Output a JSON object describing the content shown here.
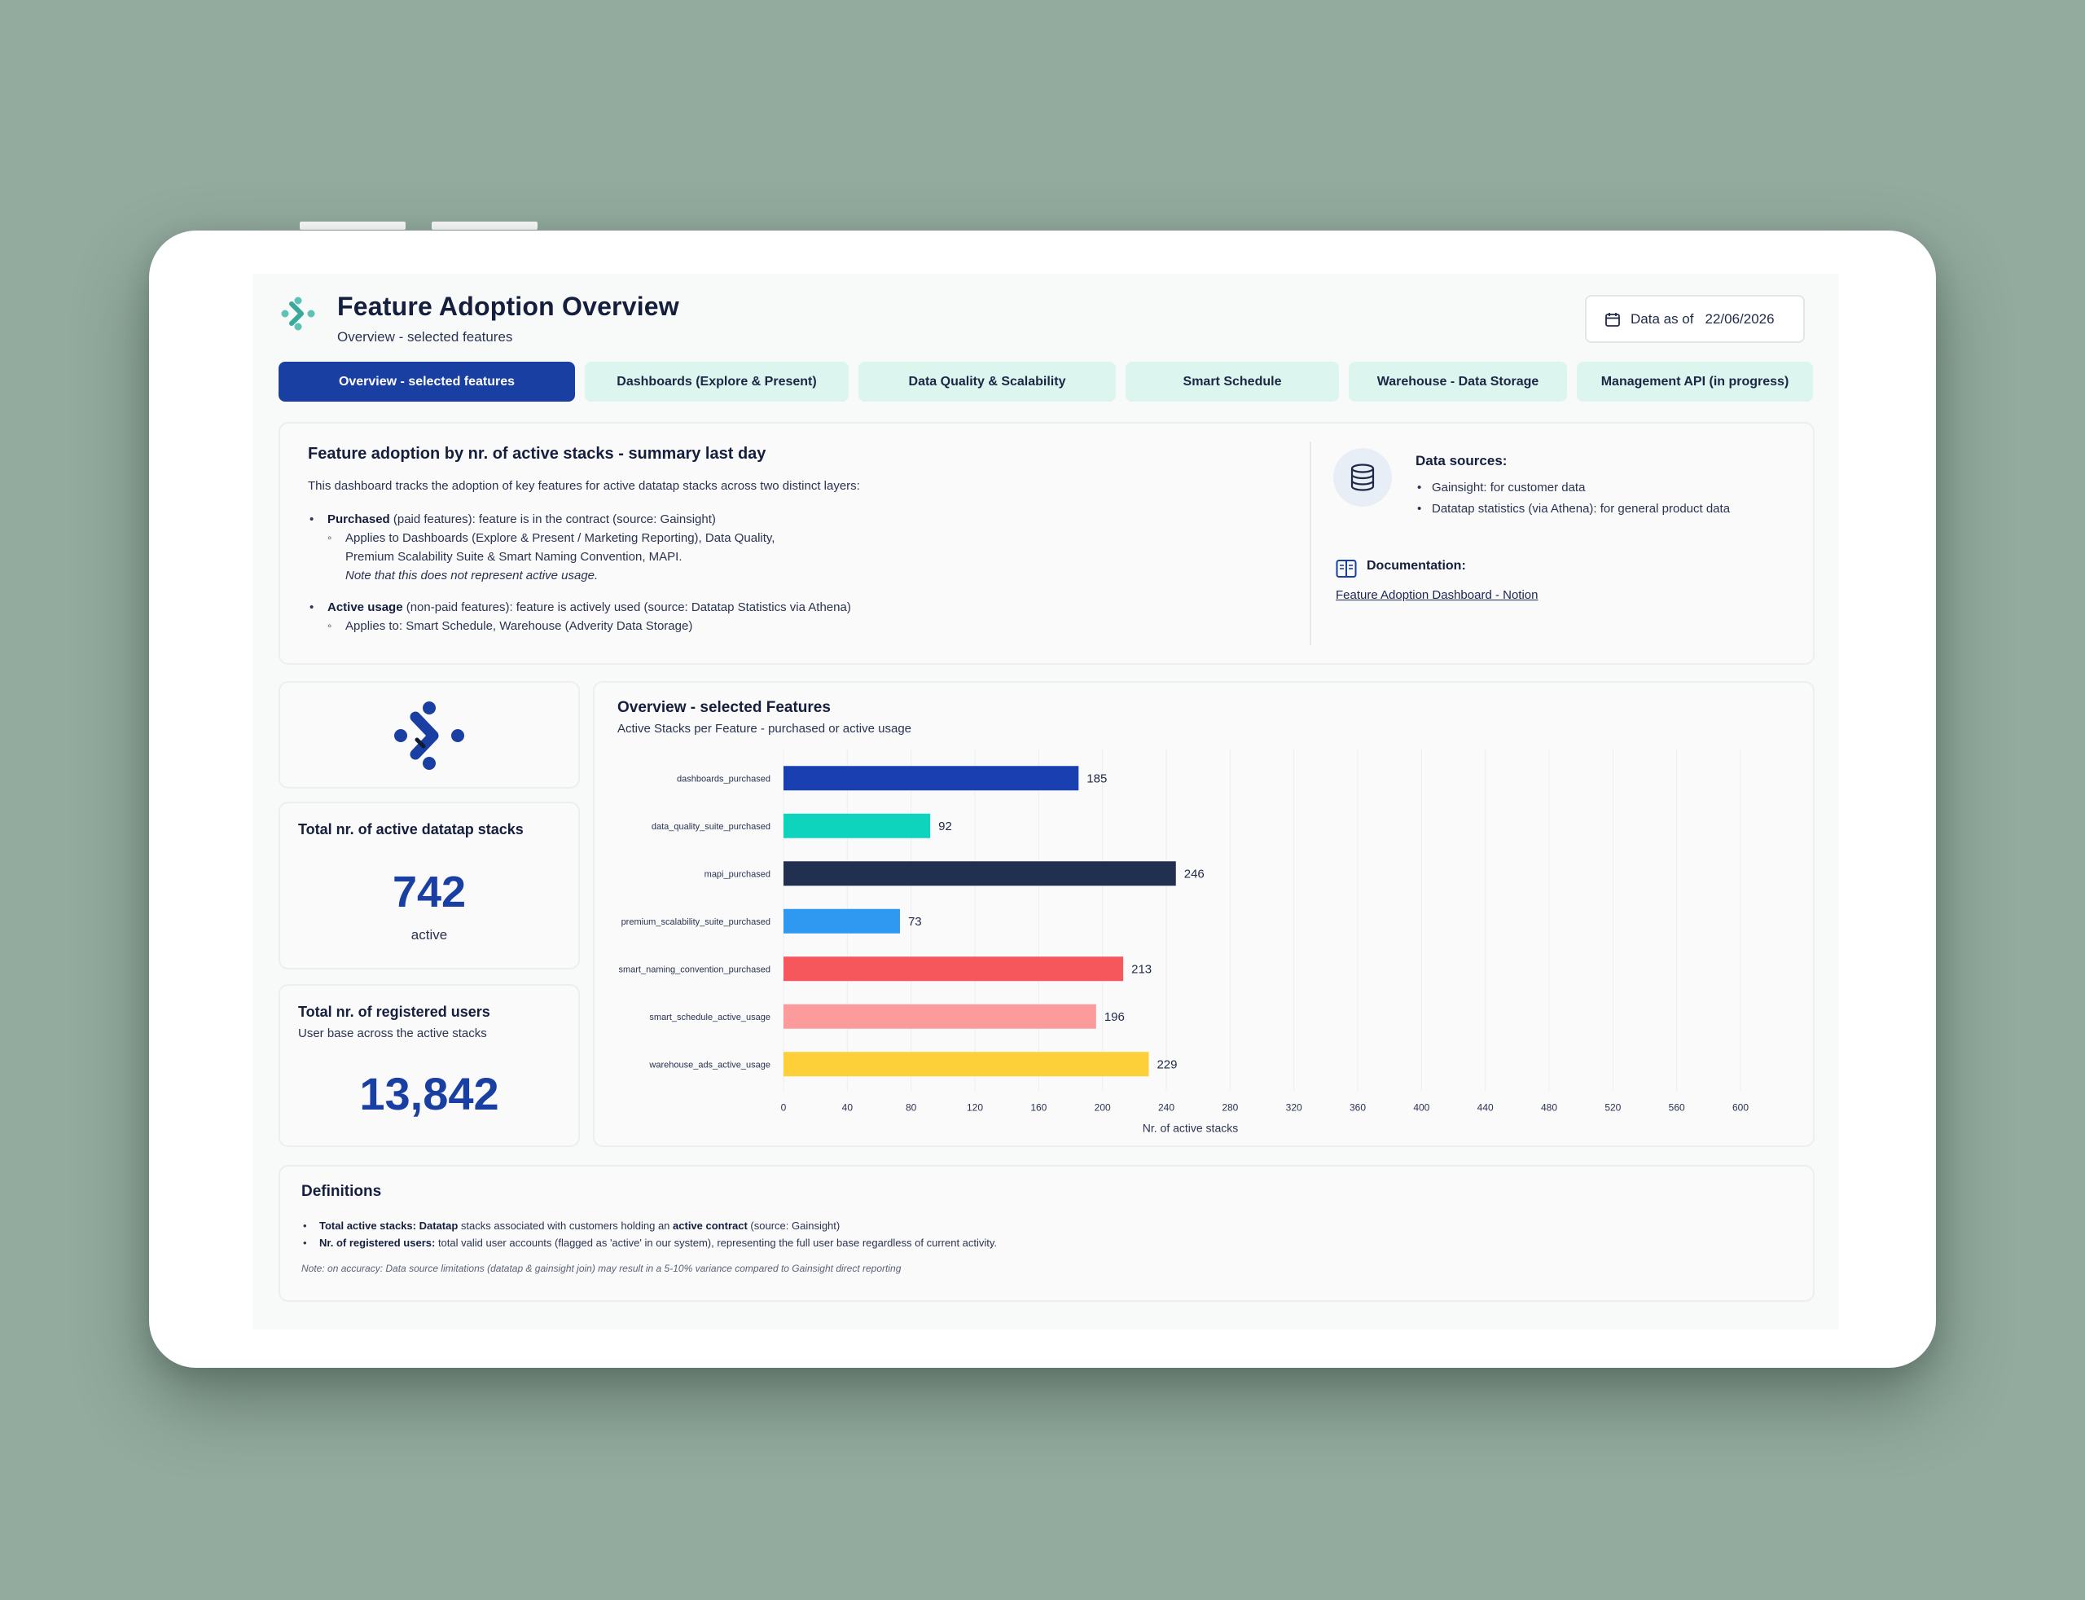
{
  "header": {
    "title": "Feature Adoption Overview",
    "subtitle": "Overview - selected features",
    "date_label": "Data as of",
    "date_value": "22/06/2026"
  },
  "tabs": [
    {
      "label": "Overview - selected features",
      "active": true
    },
    {
      "label": "Dashboards (Explore & Present)",
      "active": false
    },
    {
      "label": "Data Quality & Scalability",
      "active": false
    },
    {
      "label": "Smart Schedule",
      "active": false
    },
    {
      "label": "Warehouse - Data Storage",
      "active": false
    },
    {
      "label": "Management API (in progress)",
      "active": false
    }
  ],
  "summary": {
    "title": "Feature adoption by nr. of active stacks - summary last day",
    "intro": "This dashboard tracks the adoption of key features for active datatap stacks across two distinct layers:",
    "purchased_label": "Purchased",
    "purchased_text": " (paid features): feature is in the contract (source: Gainsight)",
    "purchased_applies_1": "Applies to Dashboards (Explore & Present / Marketing Reporting), Data Quality,",
    "purchased_applies_2": "Premium Scalability Suite & Smart Naming Convention, MAPI.",
    "purchased_note": "Note that this does not represent active usage.",
    "active_label": "Active usage",
    "active_text": " (non-paid features): feature is actively used (source: Datatap Statistics via Athena)",
    "active_applies": "Applies to: Smart Schedule, Warehouse (Adverity Data Storage)"
  },
  "data_sources": {
    "title": "Data sources:",
    "items": [
      "Gainsight: for customer data",
      "Datatap statistics (via Athena): for general product data"
    ]
  },
  "documentation": {
    "title": "Documentation:",
    "link": "Feature Adoption Dashboard - Notion"
  },
  "kpis": {
    "active_stacks": {
      "title": "Total nr. of active datatap stacks",
      "value": "742",
      "sub": "active"
    },
    "registered_users": {
      "title": "Total nr. of registered users",
      "desc": "User base across the active stacks",
      "value": "13,842"
    }
  },
  "chart_panel": {
    "title": "Overview - selected Features",
    "subtitle": "Active Stacks per Feature - purchased or active usage"
  },
  "chart_data": {
    "type": "bar",
    "orientation": "horizontal",
    "categories": [
      "dashboards_purchased",
      "data_quality_suite_purchased",
      "mapi_purchased",
      "premium_scalability_suite_purchased",
      "smart_naming_convention_purchased",
      "smart_schedule_active_usage",
      "warehouse_ads_active_usage"
    ],
    "values": [
      185,
      92,
      246,
      73,
      213,
      196,
      229
    ],
    "colors": [
      "#1a3fb0",
      "#0ed4bd",
      "#22304f",
      "#2f98f0",
      "#f5575c",
      "#fb9b9b",
      "#fdd03a"
    ],
    "xlabel": "Nr. of active stacks",
    "xlim": [
      0,
      600
    ],
    "xticks": [
      0,
      40,
      80,
      120,
      160,
      200,
      240,
      280,
      320,
      360,
      400,
      440,
      480,
      520,
      560,
      600
    ],
    "grid": true
  },
  "definitions": {
    "title": "Definitions",
    "d1_bold": "Total active stacks: Datatap",
    "d1_text": " stacks associated with customers holding an ",
    "d1_bold2": "active contract",
    "d1_tail": " (source: Gainsight)",
    "d2_bold": "Nr. of registered users:",
    "d2_text": " total valid user accounts (flagged as 'active' in our system), representing the full user base regardless of current activity.",
    "note": "Note: on accuracy: Data source limitations (datatap & gainsight join) may result in a 5-10% variance compared to Gainsight direct reporting"
  },
  "colors": {
    "brand_blue": "#1a3fa3",
    "tab_inactive": "#dcf5ee",
    "background": "#93aa9e"
  }
}
